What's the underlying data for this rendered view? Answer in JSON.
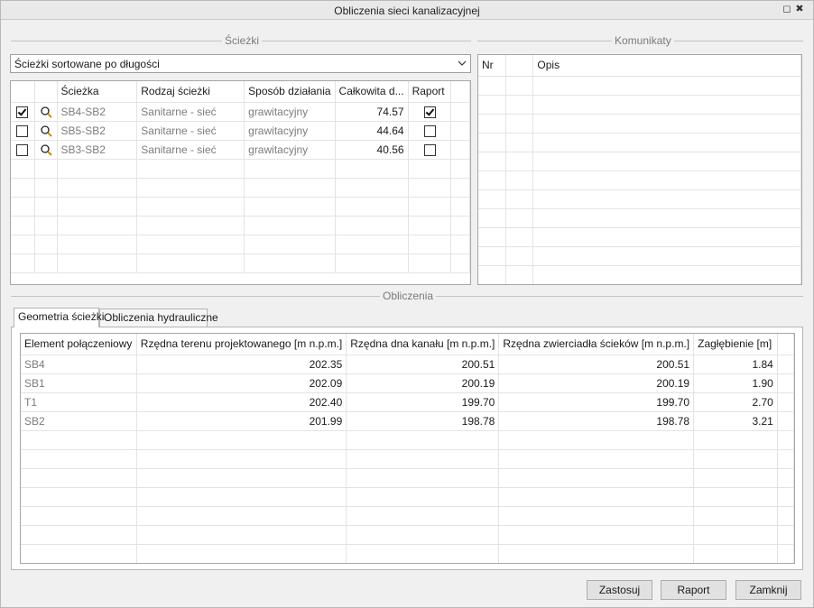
{
  "window": {
    "title": "Obliczenia sieci kanalizacyjnej",
    "restore_glyph": "◻",
    "close_glyph": "✖"
  },
  "paths_group": {
    "title": "Ścieżki",
    "sort_combo": {
      "selected": "Ścieżki sortowane po długości"
    },
    "columns": [
      "",
      "",
      "Ścieżka",
      "Rodzaj ścieżki",
      "Sposób działania",
      "Całkowita d...",
      "Raport"
    ],
    "rows": [
      {
        "checked": true,
        "path": "SB4-SB2",
        "type": "Sanitarne - sieć",
        "mode": "grawitacyjny",
        "length": "74.57",
        "report": true
      },
      {
        "checked": false,
        "path": "SB5-SB2",
        "type": "Sanitarne - sieć",
        "mode": "grawitacyjny",
        "length": "44.64",
        "report": false
      },
      {
        "checked": false,
        "path": "SB3-SB2",
        "type": "Sanitarne - sieć",
        "mode": "grawitacyjny",
        "length": "40.56",
        "report": false
      }
    ]
  },
  "messages_group": {
    "title": "Komunikaty",
    "columns": [
      "Nr",
      "",
      "Opis"
    ]
  },
  "calc_group": {
    "title": "Obliczenia",
    "tabs": [
      {
        "label": "Geometria ścieżki",
        "active": true
      },
      {
        "label": "Obliczenia hydrauliczne",
        "active": false
      }
    ],
    "columns": [
      "Element połączeniowy",
      "Rzędna terenu projektowanego [m n.p.m.]",
      "Rzędna dna kanału [m n.p.m.]",
      "Rzędna zwierciadła ścieków [m n.p.m.]",
      "Zagłębienie [m]",
      ""
    ],
    "rows": [
      {
        "element": "SB4",
        "terrain": "202.35",
        "bottom": "200.51",
        "water": "200.51",
        "depth": "1.84"
      },
      {
        "element": "SB1",
        "terrain": "202.09",
        "bottom": "200.19",
        "water": "200.19",
        "depth": "1.90"
      },
      {
        "element": "T1",
        "terrain": "202.40",
        "bottom": "199.70",
        "water": "199.70",
        "depth": "2.70"
      },
      {
        "element": "SB2",
        "terrain": "201.99",
        "bottom": "198.78",
        "water": "198.78",
        "depth": "3.21"
      }
    ]
  },
  "buttons": {
    "apply": "Zastosuj",
    "report": "Raport",
    "close": "Zamknij"
  }
}
